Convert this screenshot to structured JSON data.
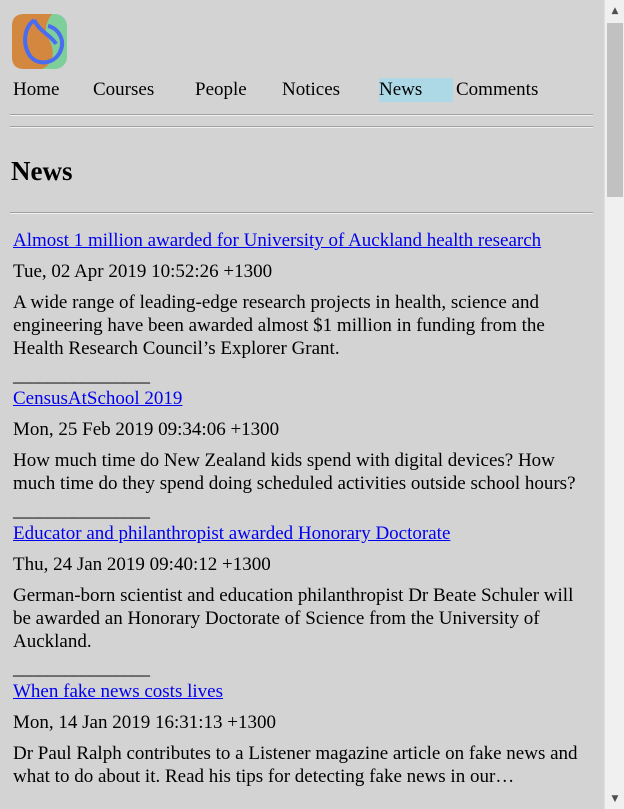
{
  "logo": {
    "icon": "site-logo-icon",
    "colors": {
      "orange": "#d4873e",
      "blue": "#4a6cf0",
      "green": "#7fcf9a"
    }
  },
  "nav": {
    "items": [
      {
        "label": "Home"
      },
      {
        "label": "Courses"
      },
      {
        "label": "People"
      },
      {
        "label": "Notices"
      },
      {
        "label": "News",
        "active": true
      },
      {
        "label": "Comments"
      }
    ]
  },
  "page": {
    "title": "News"
  },
  "news": {
    "separator": "________________",
    "items": [
      {
        "title": "Almost 1 million awarded for University of Auckland health research",
        "date": "Tue, 02 Apr 2019 10:52:26 +1300",
        "summary": "A wide range of leading-edge research projects in health, science and engineering have been awarded almost $1 million in funding from the Health Research Council’s Explorer Grant."
      },
      {
        "title": "CensusAtSchool 2019",
        "date": "Mon, 25 Feb 2019 09:34:06 +1300",
        "summary": "How much time do New Zealand kids spend with digital devices? How much time do they spend doing scheduled activities outside school hours?"
      },
      {
        "title": "Educator and philanthropist awarded Honorary Doctorate",
        "date": "Thu, 24 Jan 2019 09:40:12 +1300",
        "summary": "German-born scientist and education philanthropist Dr Beate Schuler will be awarded an Honorary Doctorate of Science from the University of Auckland."
      },
      {
        "title": "When fake news costs lives",
        "date": "Mon, 14 Jan 2019 16:31:13 +1300",
        "summary": "Dr Paul Ralph contributes to a Listener magazine article on fake news and what to do about it. Read his tips for detecting fake news in our…"
      }
    ]
  },
  "scrollbar": {
    "up_icon": "scroll-up-arrow-icon",
    "down_icon": "scroll-down-arrow-icon",
    "position": 0.0
  }
}
